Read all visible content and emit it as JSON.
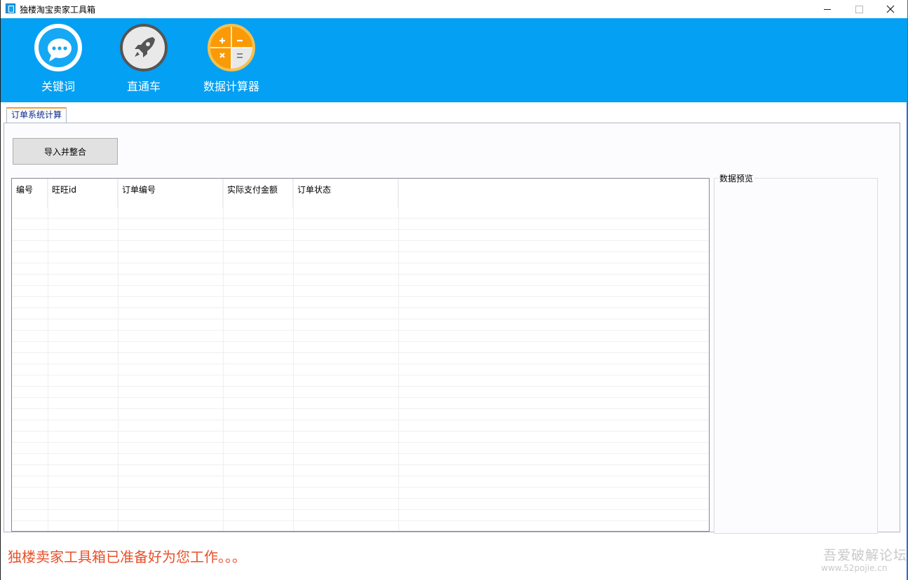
{
  "window": {
    "title": "独楼淘宝卖家工具箱"
  },
  "toolbar": {
    "items": [
      {
        "label": "关键词",
        "icon": "chat-bubble-icon"
      },
      {
        "label": "直通车",
        "icon": "rocket-icon"
      },
      {
        "label": "数据计算器",
        "icon": "calculator-icon"
      }
    ]
  },
  "tabs": [
    {
      "label": "订单系统计算",
      "active": true
    }
  ],
  "actions": {
    "import_label": "导入并整合"
  },
  "table": {
    "columns": [
      "编号",
      "旺旺id",
      "订单编号",
      "实际支付金额",
      "订单状态"
    ],
    "rows": []
  },
  "preview": {
    "title": "数据预览"
  },
  "status": {
    "message": "独楼卖家工具箱已准备好为您工作。。。"
  },
  "watermark": {
    "main": "吾爱破解论坛",
    "sub": "www.52pojie.cn"
  },
  "colors": {
    "toolbar_bg": "#03a0f4",
    "status_text": "#e8502a",
    "tab_accent": "#f0a030"
  }
}
